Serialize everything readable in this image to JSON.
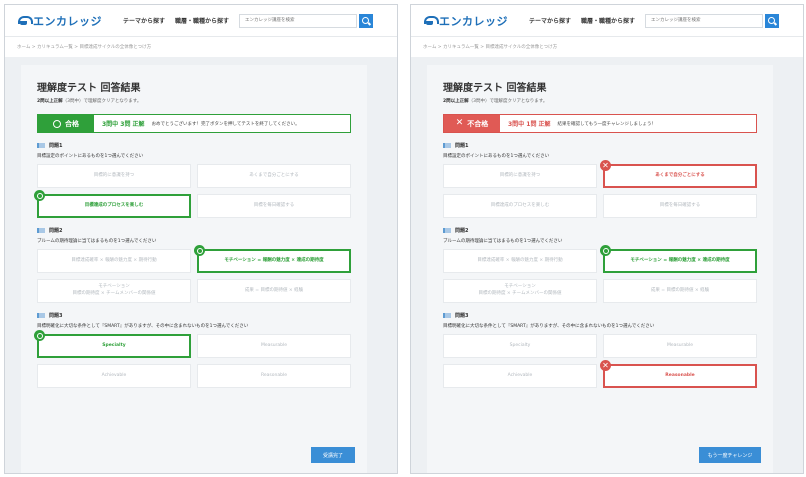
{
  "header": {
    "logo_text": "エンカレッジ",
    "logo_icon": "graduation-cap-icon",
    "nav": [
      "テーマから探す",
      "職層・職種から探す"
    ],
    "search_placeholder": "エンカレッジ講座を検索",
    "search_icon": "search-icon"
  },
  "breadcrumb": "ホーム > カリキュラム一覧 > 目標達成サイクルの全体像とつけ方",
  "panels": {
    "pass": {
      "title": "理解度テスト 回答結果",
      "score_bold": "2問以上正解",
      "score_rest": "（3問中）で理解度クリアとなります。",
      "result_label": "合格",
      "result_count": "3問中 3問 正解",
      "result_msg": "おめでとうございます！完了ボタンを押してテストを終了してください。",
      "questions": [
        {
          "head": "問題1",
          "text": "目標設定のポイントにあるものを1つ選んでください",
          "options": [
            {
              "label": "目標的に意識を持つ",
              "state": "none"
            },
            {
              "label": "あくまで自分ごとにする",
              "state": "none"
            },
            {
              "label": "目標達成のプロセスを楽しむ",
              "state": "correct"
            },
            {
              "label": "目標を毎日確認する",
              "state": "none"
            }
          ]
        },
        {
          "head": "問題2",
          "text": "ブルームの期待理論に当てはまるものを1つ選んでください",
          "options": [
            {
              "label": "目標達成確率 × 報酬の魅力度 × 期待行動",
              "state": "none"
            },
            {
              "label": "モチベーション = 報酬の魅力度 × 達成の期待度",
              "state": "correct"
            },
            {
              "label": "モチベーション\n目標の期待度 × チームメンバーの関係値",
              "state": "none"
            },
            {
              "label": "成果 = 目標の期待値 × 経験",
              "state": "none"
            }
          ]
        },
        {
          "head": "問題3",
          "text": "目標明確化に大切な条件として『SMART』がありますが、その中に含まれないものを1つ選んでください",
          "options": [
            {
              "label": "Specialty",
              "state": "correct"
            },
            {
              "label": "Measurable",
              "state": "none"
            },
            {
              "label": "Achievable",
              "state": "none"
            },
            {
              "label": "Reasonable",
              "state": "none"
            }
          ]
        }
      ],
      "action_label": "受講完了"
    },
    "fail": {
      "title": "理解度テスト 回答結果",
      "score_bold": "2問以上正解",
      "score_rest": "（3問中）で理解度クリアとなります。",
      "result_label": "不合格",
      "result_count": "3問中 1問 正解",
      "result_msg": "結果を確認してもう一度チャレンジしましょう！",
      "questions": [
        {
          "head": "問題1",
          "text": "目標設定のポイントにあるものを1つ選んでください",
          "options": [
            {
              "label": "目標的に意識を持つ",
              "state": "none"
            },
            {
              "label": "あくまで自分ごとにする",
              "state": "wrong"
            },
            {
              "label": "目標達成のプロセスを楽しむ",
              "state": "none"
            },
            {
              "label": "目標を毎日確認する",
              "state": "none"
            }
          ]
        },
        {
          "head": "問題2",
          "text": "ブルームの期待理論に当てはまるものを1つ選んでください",
          "options": [
            {
              "label": "目標達成確率 × 報酬の魅力度 × 期待行動",
              "state": "none"
            },
            {
              "label": "モチベーション = 報酬の魅力度 × 達成の期待度",
              "state": "correct"
            },
            {
              "label": "モチベーション\n目標の期待度 × チームメンバーの関係値",
              "state": "none"
            },
            {
              "label": "成果 = 目標の期待値 × 経験",
              "state": "none"
            }
          ]
        },
        {
          "head": "問題3",
          "text": "目標明確化に大切な条件として『SMART』がありますが、その中に含まれないものを1つ選んでください",
          "options": [
            {
              "label": "Specialty",
              "state": "none"
            },
            {
              "label": "Measurable",
              "state": "none"
            },
            {
              "label": "Achievable",
              "state": "none"
            },
            {
              "label": "Reasonable",
              "state": "wrong"
            }
          ]
        }
      ],
      "action_label": "もう一度チャレンジ"
    }
  },
  "colors": {
    "brand": "#1e6fb8",
    "pass": "#2fa03a",
    "fail": "#d9534f",
    "button": "#3a8ed6"
  }
}
